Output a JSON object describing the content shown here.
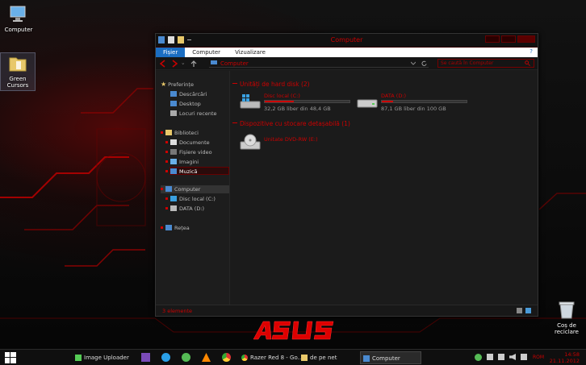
{
  "desktop": {
    "icons": [
      {
        "label": "Computer"
      },
      {
        "label": "Green Cursors"
      },
      {
        "label": "Coș de reciclare"
      }
    ]
  },
  "window": {
    "title": "Computer",
    "ribbon": {
      "tabs": [
        "Fișier",
        "Computer",
        "Vizualizare"
      ],
      "help": "?"
    },
    "address": {
      "path": "Computer"
    },
    "search": {
      "placeholder": "Se caută în Computer"
    },
    "sidebar": {
      "favorites": {
        "label": "Preferințe",
        "items": [
          "Descărcări",
          "Desktop",
          "Locuri recente"
        ]
      },
      "libraries": {
        "label": "Biblioteci",
        "items": [
          "Documente",
          "Fișiere video",
          "Imagini",
          "Muzică"
        ]
      },
      "computer": {
        "label": "Computer",
        "items": [
          "Disc local (C:)",
          "DATA (D:)"
        ]
      },
      "network": {
        "label": "Rețea"
      }
    },
    "groups": {
      "hdd": {
        "label": "Unități de hard disk (2)"
      },
      "removable": {
        "label": "Dispozitive cu stocare detașabilă (1)"
      }
    },
    "drives": [
      {
        "name": "Disc local (C:)",
        "free": "32,2 GB liber din 48,4 GB",
        "used_fraction": 0.34
      },
      {
        "name": "DATA (D:)",
        "free": "87,1 GB liber din 100 GB",
        "used_fraction": 0.13
      }
    ],
    "dvd": {
      "name": "Unitate DVD-RW (E:)"
    },
    "status": {
      "count": "3 elemente"
    }
  },
  "taskbar": {
    "items": [
      {
        "label": "Image Uploader"
      },
      {
        "label": "Razer Red 8 - Go..."
      },
      {
        "label": "de pe net"
      },
      {
        "label": "Computer"
      }
    ],
    "lang": "ROM",
    "time": "14:58",
    "date": "21.11.2012"
  },
  "colors": {
    "accent": "#cc0000",
    "ribbon_active": "#1b6ec2"
  }
}
